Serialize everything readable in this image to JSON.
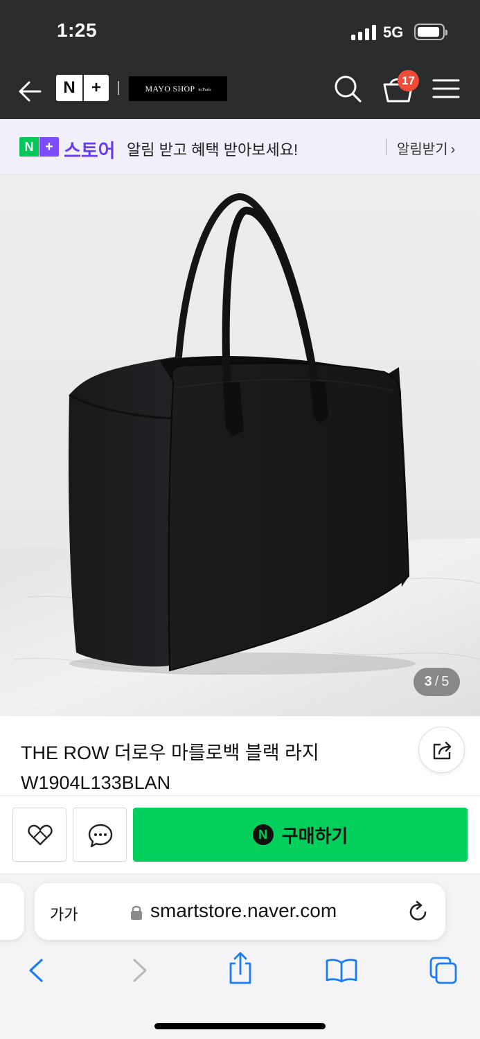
{
  "status_bar": {
    "time": "1:25",
    "network": "5G"
  },
  "header": {
    "brand_logo": {
      "left": "N",
      "right": "+"
    },
    "shop_logo": {
      "name": "MAYO SHOP",
      "sub": "in Paris"
    },
    "cart_count": "17",
    "icons": [
      "back-arrow-icon",
      "search-icon",
      "cart-icon",
      "menu-icon"
    ]
  },
  "notice": {
    "badge_n": "N",
    "badge_plus": "+",
    "store_label": "스토어",
    "message": "알림 받고 혜택 받아보세요!",
    "action_label": "알림받기",
    "action_chevron": "›"
  },
  "product": {
    "image_index": "3",
    "image_separator": "/",
    "image_total": "5",
    "title_line1": "THE ROW 더로우 마를로백 블랙 라지",
    "title_line2": "W1904L133BLAN"
  },
  "actions": {
    "buy_icon_letter": "N",
    "buy_label": "구매하기"
  },
  "browser": {
    "text_size_label": "가가",
    "url": "smartstore.naver.com"
  },
  "colors": {
    "header_bg": "#2b2c2e",
    "naver_green": "#03c75a",
    "buy_green": "#03cf5d",
    "plus_purple": "#7b4dff",
    "badge_red": "#f04a38",
    "safari_blue": "#1a7cf5"
  }
}
